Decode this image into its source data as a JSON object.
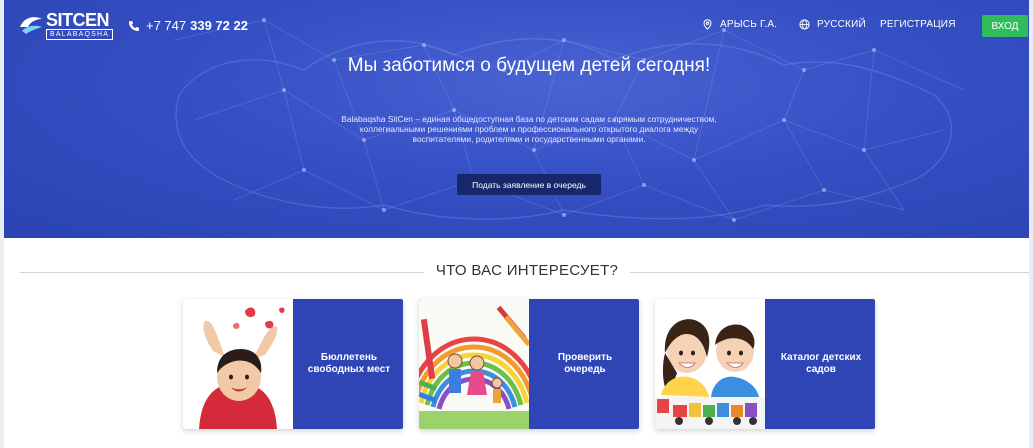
{
  "header": {
    "logo": {
      "title": "SITCEN",
      "subtitle": "BALABAQSHA"
    },
    "phone": {
      "prefix": "+7 747",
      "number": "339 72 22"
    },
    "nav": {
      "city": "АРЫСЬ Г.А.",
      "language": "РУССКИЙ",
      "register": "РЕГИСТРАЦИЯ",
      "login": "ВХОД"
    }
  },
  "hero": {
    "title": "Мы заботимся о будущем детей сегодня!",
    "description": "Balabaqsha SitCen – единая общедоступная база по детским садам с прямым сотрудничеством, коллегиальными решениями проблем и профессионального открытого диалога между воспитателями, родителями и государственными органами.",
    "apply_button": "Подать заявление в очередь"
  },
  "section": {
    "title": "ЧТО ВАС ИНТЕРЕСУЕТ?"
  },
  "cards": [
    {
      "label": "Бюллетень свободных мест",
      "icon": "toddler-photo"
    },
    {
      "label": "Проверить очередь",
      "icon": "family-drawing-photo"
    },
    {
      "label": "Каталог детских садов",
      "icon": "children-photo"
    }
  ],
  "colors": {
    "hero_blue": "#3550c4",
    "card_blue": "#2f45b6",
    "login_green": "#2ebd5a",
    "apply_navy": "#16286b"
  }
}
